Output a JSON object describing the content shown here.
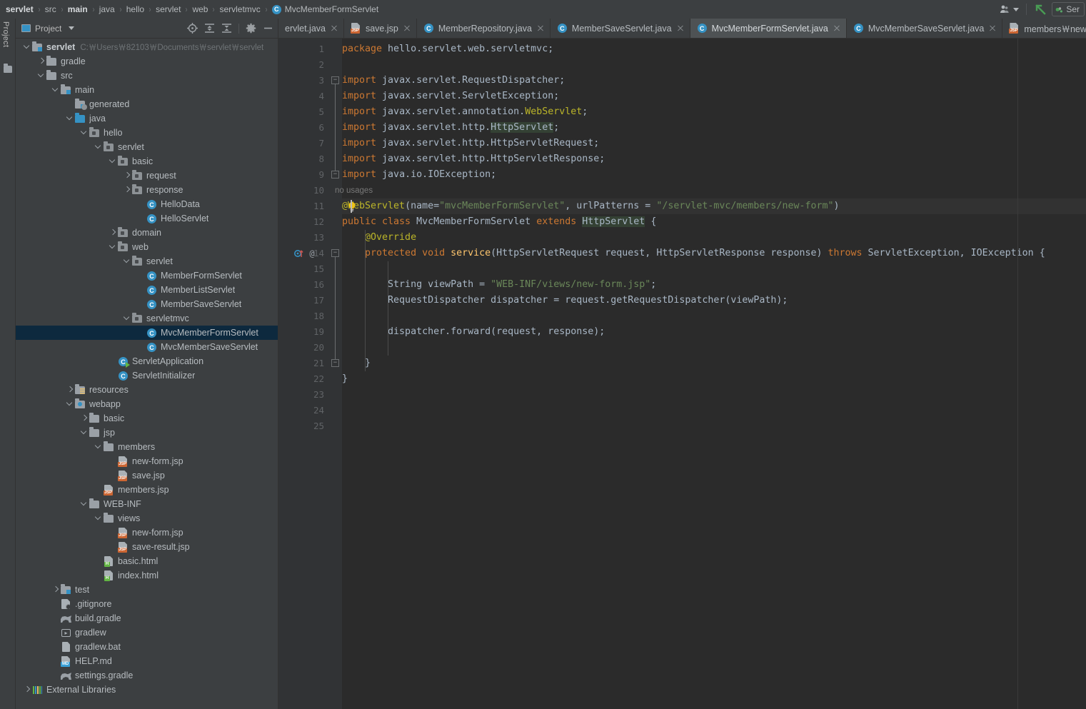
{
  "breadcrumb": {
    "items": [
      {
        "label": "servlet",
        "bold": true
      },
      {
        "label": "src",
        "bold": false
      },
      {
        "label": "main",
        "bold": true
      },
      {
        "label": "java",
        "bold": false
      },
      {
        "label": "hello",
        "bold": false
      },
      {
        "label": "servlet",
        "bold": false
      },
      {
        "label": "web",
        "bold": false
      },
      {
        "label": "servletmvc",
        "bold": false
      }
    ],
    "current": "MvcMemberFormServlet",
    "current_icon": "class-icon",
    "separator": "›"
  },
  "topbar_right": {
    "account_icon": "user-account-icon",
    "account_caret": "chevron-down-icon",
    "vcs_icon": "vcs-update-arrow-icon",
    "run_widget": {
      "icon": "run-configuration-icon",
      "label": "Ser"
    }
  },
  "left_strip": {
    "label": "Project",
    "icon": "project-folder-icon"
  },
  "project_panel": {
    "title": "Project",
    "title_icon": "project-view-icon",
    "caret": "chevron-down-icon",
    "tools": [
      {
        "name": "locate-in-tree-icon"
      },
      {
        "name": "expand-all-icon"
      },
      {
        "name": "collapse-all-icon"
      },
      {
        "name": "settings-gear-icon"
      },
      {
        "name": "hide-panel-icon"
      }
    ]
  },
  "tree": [
    {
      "indent": 0,
      "arrow": "down",
      "icon": "folder-module",
      "label": "servlet",
      "sub": "C:￦Users￦82103￦Documents￦servlet￦servlet",
      "bold": true,
      "selected": false
    },
    {
      "indent": 1,
      "arrow": "right",
      "icon": "folder-plain",
      "label": "gradle",
      "sub": "",
      "bold": false,
      "selected": false
    },
    {
      "indent": 1,
      "arrow": "down",
      "icon": "folder-plain",
      "label": "src",
      "sub": "",
      "bold": false,
      "selected": false
    },
    {
      "indent": 2,
      "arrow": "down",
      "icon": "folder-module",
      "label": "main",
      "sub": "",
      "bold": false,
      "selected": false
    },
    {
      "indent": 3,
      "arrow": "none",
      "icon": "folder-generated",
      "label": "generated",
      "sub": "",
      "bold": false,
      "selected": false
    },
    {
      "indent": 3,
      "arrow": "down",
      "icon": "folder-source",
      "label": "java",
      "sub": "",
      "bold": false,
      "selected": false
    },
    {
      "indent": 4,
      "arrow": "down",
      "icon": "folder-package",
      "label": "hello",
      "sub": "",
      "bold": false,
      "selected": false
    },
    {
      "indent": 5,
      "arrow": "down",
      "icon": "folder-package",
      "label": "servlet",
      "sub": "",
      "bold": false,
      "selected": false
    },
    {
      "indent": 6,
      "arrow": "down",
      "icon": "folder-package",
      "label": "basic",
      "sub": "",
      "bold": false,
      "selected": false
    },
    {
      "indent": 7,
      "arrow": "right",
      "icon": "folder-package",
      "label": "request",
      "sub": "",
      "bold": false,
      "selected": false
    },
    {
      "indent": 7,
      "arrow": "right",
      "icon": "folder-package",
      "label": "response",
      "sub": "",
      "bold": false,
      "selected": false
    },
    {
      "indent": 8,
      "arrow": "none",
      "icon": "java-class",
      "label": "HelloData",
      "sub": "",
      "bold": false,
      "selected": false
    },
    {
      "indent": 8,
      "arrow": "none",
      "icon": "java-class",
      "label": "HelloServlet",
      "sub": "",
      "bold": false,
      "selected": false
    },
    {
      "indent": 6,
      "arrow": "right",
      "icon": "folder-package",
      "label": "domain",
      "sub": "",
      "bold": false,
      "selected": false
    },
    {
      "indent": 6,
      "arrow": "down",
      "icon": "folder-package",
      "label": "web",
      "sub": "",
      "bold": false,
      "selected": false
    },
    {
      "indent": 7,
      "arrow": "down",
      "icon": "folder-package",
      "label": "servlet",
      "sub": "",
      "bold": false,
      "selected": false
    },
    {
      "indent": 8,
      "arrow": "none",
      "icon": "java-class",
      "label": "MemberFormServlet",
      "sub": "",
      "bold": false,
      "selected": false
    },
    {
      "indent": 8,
      "arrow": "none",
      "icon": "java-class",
      "label": "MemberListServlet",
      "sub": "",
      "bold": false,
      "selected": false
    },
    {
      "indent": 8,
      "arrow": "none",
      "icon": "java-class",
      "label": "MemberSaveServlet",
      "sub": "",
      "bold": false,
      "selected": false
    },
    {
      "indent": 7,
      "arrow": "down",
      "icon": "folder-package",
      "label": "servletmvc",
      "sub": "",
      "bold": false,
      "selected": false
    },
    {
      "indent": 8,
      "arrow": "none",
      "icon": "java-class",
      "label": "MvcMemberFormServlet",
      "sub": "",
      "bold": false,
      "selected": true
    },
    {
      "indent": 8,
      "arrow": "none",
      "icon": "java-class",
      "label": "MvcMemberSaveServlet",
      "sub": "",
      "bold": false,
      "selected": false
    },
    {
      "indent": 6,
      "arrow": "none",
      "icon": "java-class-runnable",
      "label": "ServletApplication",
      "sub": "",
      "bold": false,
      "selected": false
    },
    {
      "indent": 6,
      "arrow": "none",
      "icon": "java-class",
      "label": "ServletInitializer",
      "sub": "",
      "bold": false,
      "selected": false
    },
    {
      "indent": 3,
      "arrow": "right",
      "icon": "folder-resources",
      "label": "resources",
      "sub": "",
      "bold": false,
      "selected": false
    },
    {
      "indent": 3,
      "arrow": "down",
      "icon": "folder-webapp",
      "label": "webapp",
      "sub": "",
      "bold": false,
      "selected": false
    },
    {
      "indent": 4,
      "arrow": "right",
      "icon": "folder-plain",
      "label": "basic",
      "sub": "",
      "bold": false,
      "selected": false
    },
    {
      "indent": 4,
      "arrow": "down",
      "icon": "folder-plain",
      "label": "jsp",
      "sub": "",
      "bold": false,
      "selected": false
    },
    {
      "indent": 5,
      "arrow": "down",
      "icon": "folder-plain",
      "label": "members",
      "sub": "",
      "bold": false,
      "selected": false
    },
    {
      "indent": 6,
      "arrow": "none",
      "icon": "jsp-file",
      "label": "new-form.jsp",
      "sub": "",
      "bold": false,
      "selected": false
    },
    {
      "indent": 6,
      "arrow": "none",
      "icon": "jsp-file",
      "label": "save.jsp",
      "sub": "",
      "bold": false,
      "selected": false
    },
    {
      "indent": 5,
      "arrow": "none",
      "icon": "jsp-file",
      "label": "members.jsp",
      "sub": "",
      "bold": false,
      "selected": false
    },
    {
      "indent": 4,
      "arrow": "down",
      "icon": "folder-plain",
      "label": "WEB-INF",
      "sub": "",
      "bold": false,
      "selected": false
    },
    {
      "indent": 5,
      "arrow": "down",
      "icon": "folder-plain",
      "label": "views",
      "sub": "",
      "bold": false,
      "selected": false
    },
    {
      "indent": 6,
      "arrow": "none",
      "icon": "jsp-file",
      "label": "new-form.jsp",
      "sub": "",
      "bold": false,
      "selected": false
    },
    {
      "indent": 6,
      "arrow": "none",
      "icon": "jsp-file",
      "label": "save-result.jsp",
      "sub": "",
      "bold": false,
      "selected": false
    },
    {
      "indent": 5,
      "arrow": "none",
      "icon": "html-file",
      "label": "basic.html",
      "sub": "",
      "bold": false,
      "selected": false
    },
    {
      "indent": 5,
      "arrow": "none",
      "icon": "html-file",
      "label": "index.html",
      "sub": "",
      "bold": false,
      "selected": false
    },
    {
      "indent": 2,
      "arrow": "right",
      "icon": "folder-module",
      "label": "test",
      "sub": "",
      "bold": false,
      "selected": false
    },
    {
      "indent": 2,
      "arrow": "none",
      "icon": "gitignore-file",
      "label": ".gitignore",
      "sub": "",
      "bold": false,
      "selected": false
    },
    {
      "indent": 2,
      "arrow": "none",
      "icon": "gradle-file",
      "label": "build.gradle",
      "sub": "",
      "bold": false,
      "selected": false
    },
    {
      "indent": 2,
      "arrow": "none",
      "icon": "gradlew-file",
      "label": "gradlew",
      "sub": "",
      "bold": false,
      "selected": false
    },
    {
      "indent": 2,
      "arrow": "none",
      "icon": "bat-file",
      "label": "gradlew.bat",
      "sub": "",
      "bold": false,
      "selected": false
    },
    {
      "indent": 2,
      "arrow": "none",
      "icon": "markdown-file",
      "label": "HELP.md",
      "sub": "",
      "bold": false,
      "selected": false
    },
    {
      "indent": 2,
      "arrow": "none",
      "icon": "gradle-file",
      "label": "settings.gradle",
      "sub": "",
      "bold": false,
      "selected": false
    },
    {
      "indent": 0,
      "arrow": "right",
      "icon": "external-libraries",
      "label": "External Libraries",
      "sub": "",
      "bold": false,
      "selected": false
    }
  ],
  "tabs": [
    {
      "label": "ervlet.java",
      "icon": "java-class",
      "active": false,
      "truncated_left": true
    },
    {
      "label": "save.jsp",
      "icon": "jsp-file",
      "active": false,
      "truncated_left": false
    },
    {
      "label": "MemberRepository.java",
      "icon": "java-class",
      "active": false,
      "truncated_left": false
    },
    {
      "label": "MemberSaveServlet.java",
      "icon": "java-class",
      "active": false,
      "truncated_left": false
    },
    {
      "label": "MvcMemberFormServlet.java",
      "icon": "java-class",
      "active": true,
      "truncated_left": false
    },
    {
      "label": "MvcMemberSaveServlet.java",
      "icon": "java-class",
      "active": false,
      "truncated_left": false
    },
    {
      "label": "members￦new-form.jsp",
      "icon": "jsp-file",
      "active": false,
      "truncated_left": false
    }
  ],
  "editor": {
    "inlay_hint": "no usages",
    "inlay_hint_line": 11,
    "caret_line": 11,
    "first_line": 1,
    "last_line": 25,
    "code_lines": [
      {
        "n": 1,
        "tokens": [
          {
            "t": "package ",
            "c": "kw"
          },
          {
            "t": "hello.servlet.web.servletmvc;",
            "c": "id"
          }
        ]
      },
      {
        "n": 2,
        "tokens": []
      },
      {
        "n": 3,
        "tokens": [
          {
            "t": "import ",
            "c": "kw"
          },
          {
            "t": "javax.servlet.RequestDispatcher;",
            "c": "id"
          }
        ]
      },
      {
        "n": 4,
        "tokens": [
          {
            "t": "import ",
            "c": "kw"
          },
          {
            "t": "javax.servlet.ServletException;",
            "c": "id"
          }
        ]
      },
      {
        "n": 5,
        "tokens": [
          {
            "t": "import ",
            "c": "kw"
          },
          {
            "t": "javax.servlet.annotation.",
            "c": "id"
          },
          {
            "t": "WebServlet",
            "c": "anno"
          },
          {
            "t": ";",
            "c": "id"
          }
        ]
      },
      {
        "n": 6,
        "tokens": [
          {
            "t": "import ",
            "c": "kw"
          },
          {
            "t": "javax.servlet.http.",
            "c": "id"
          },
          {
            "t": "HttpServlet",
            "c": "hl"
          },
          {
            "t": ";",
            "c": "id"
          }
        ]
      },
      {
        "n": 7,
        "tokens": [
          {
            "t": "import ",
            "c": "kw"
          },
          {
            "t": "javax.servlet.http.HttpServletRequest;",
            "c": "id"
          }
        ]
      },
      {
        "n": 8,
        "tokens": [
          {
            "t": "import ",
            "c": "kw"
          },
          {
            "t": "javax.servlet.http.HttpServletResponse;",
            "c": "id"
          }
        ]
      },
      {
        "n": 9,
        "tokens": [
          {
            "t": "import ",
            "c": "kw"
          },
          {
            "t": "java.io.IOException;",
            "c": "id"
          }
        ]
      },
      {
        "n": 10,
        "tokens": []
      },
      {
        "n": 11,
        "tokens": [
          {
            "t": "@WebServlet",
            "c": "anno"
          },
          {
            "t": "(name=",
            "c": "id"
          },
          {
            "t": "\"mvcMemberFormServlet\"",
            "c": "str"
          },
          {
            "t": ", urlPatterns = ",
            "c": "id"
          },
          {
            "t": "\"/servlet-mvc/members/new-form\"",
            "c": "str"
          },
          {
            "t": ")",
            "c": "id"
          }
        ]
      },
      {
        "n": 12,
        "tokens": [
          {
            "t": "public class ",
            "c": "kw"
          },
          {
            "t": "MvcMemberFormServlet ",
            "c": "id"
          },
          {
            "t": "extends ",
            "c": "kw"
          },
          {
            "t": "HttpServlet",
            "c": "hl"
          },
          {
            "t": " {",
            "c": "id"
          }
        ]
      },
      {
        "n": 13,
        "tokens": [
          {
            "t": "    @Override",
            "c": "anno"
          }
        ]
      },
      {
        "n": 14,
        "tokens": [
          {
            "t": "    protected void ",
            "c": "kw"
          },
          {
            "t": "service",
            "c": "fnm"
          },
          {
            "t": "(HttpServletRequest request, HttpServletResponse response) ",
            "c": "id"
          },
          {
            "t": "throws ",
            "c": "kw"
          },
          {
            "t": "ServletException, IOException {",
            "c": "id"
          }
        ]
      },
      {
        "n": 15,
        "tokens": []
      },
      {
        "n": 16,
        "tokens": [
          {
            "t": "        String viewPath = ",
            "c": "id"
          },
          {
            "t": "\"WEB-INF/views/new-form.jsp\"",
            "c": "str"
          },
          {
            "t": ";",
            "c": "id"
          }
        ]
      },
      {
        "n": 17,
        "tokens": [
          {
            "t": "        RequestDispatcher dispatcher = request.getRequestDispatcher(viewPath);",
            "c": "id"
          }
        ]
      },
      {
        "n": 18,
        "tokens": []
      },
      {
        "n": 19,
        "tokens": [
          {
            "t": "        dispatcher.forward(request, response);",
            "c": "id"
          }
        ]
      },
      {
        "n": 20,
        "tokens": []
      },
      {
        "n": 21,
        "tokens": [
          {
            "t": "    }",
            "c": "id"
          }
        ]
      },
      {
        "n": 22,
        "tokens": [
          {
            "t": "}",
            "c": "id"
          }
        ]
      },
      {
        "n": 23,
        "tokens": []
      },
      {
        "n": 24,
        "tokens": []
      },
      {
        "n": 25,
        "tokens": []
      }
    ],
    "gutter_icons": [
      {
        "line": 14,
        "name": "override-method-marker-icon"
      },
      {
        "line": 14,
        "name": "annotation-marker-icon"
      }
    ],
    "intention_bulb": {
      "line": 11,
      "name": "intention-bulb-icon"
    }
  },
  "colors": {
    "accent": "#3592c4",
    "keyword": "#cc7832",
    "string": "#6a8759",
    "annotation": "#bbb529",
    "method": "#ffc66d",
    "selection": "#0d293e",
    "editor_bg": "#2b2b2b",
    "panel_bg": "#3c3f41"
  }
}
